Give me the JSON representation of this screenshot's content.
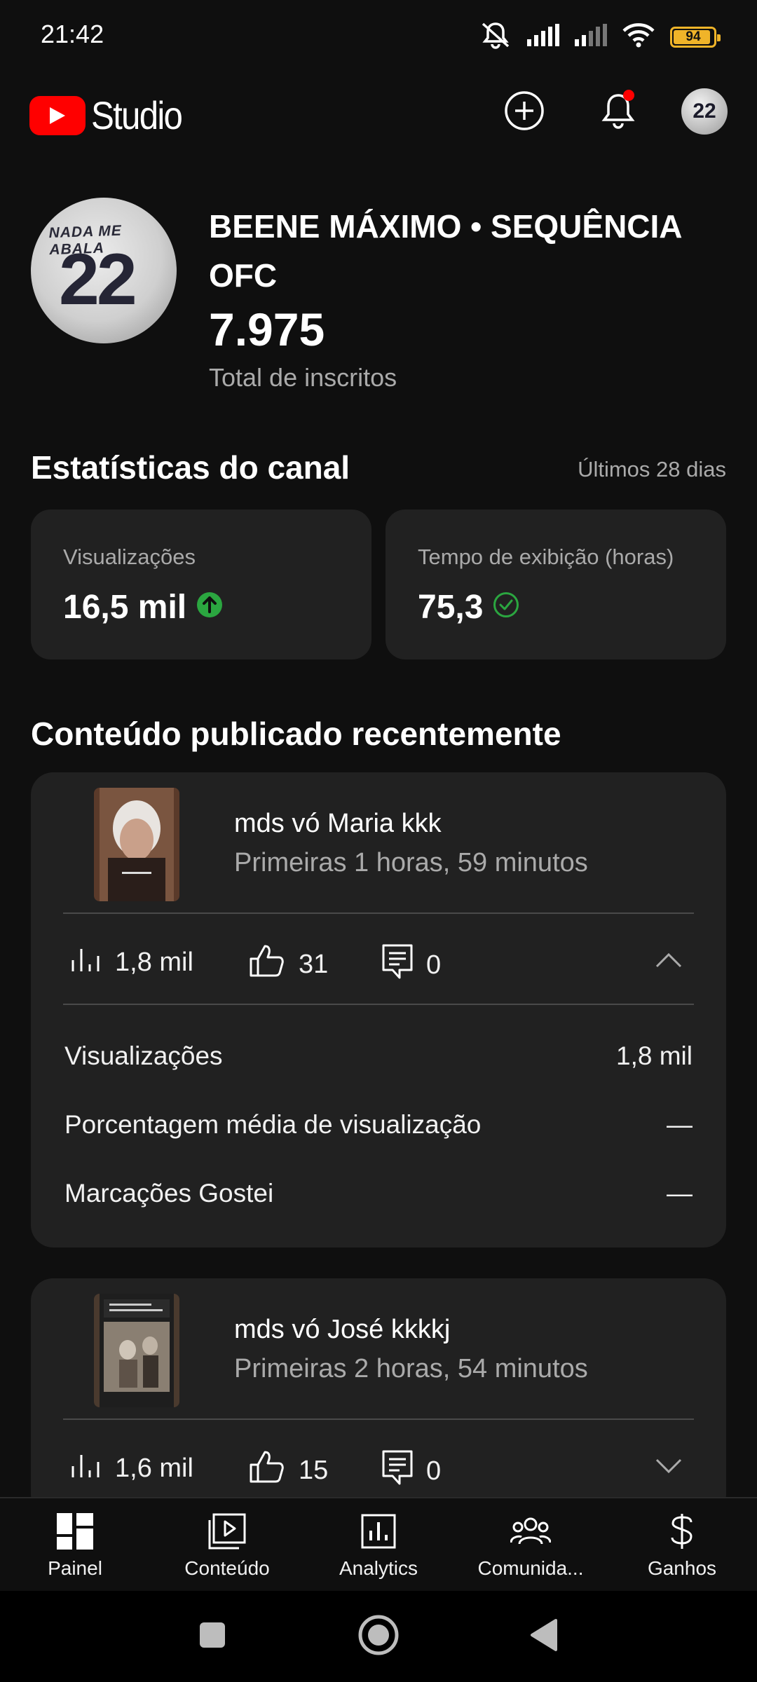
{
  "status_bar": {
    "time": "21:42",
    "battery": "94",
    "battery_level": 0.94,
    "icons": [
      "mute-icon",
      "signal-icon",
      "signal-icon",
      "wifi-icon",
      "battery-icon"
    ]
  },
  "header": {
    "app_name": "Studio",
    "avatar_text": "22"
  },
  "channel": {
    "name": "BEENE MÁXIMO • SEQUÊNCIA OFC",
    "subscribers": "7.975",
    "subscribers_label": "Total de inscritos",
    "avatar_top_text": "NADA ME ABALA",
    "avatar_number": "22"
  },
  "stats": {
    "title": "Estatísticas do canal",
    "period": "Últimos 28 dias",
    "cards": [
      {
        "label": "Visualizações",
        "value": "16,5 mil",
        "indicator": "arrow-up-icon",
        "indicator_color": "#2ba640"
      },
      {
        "label": "Tempo de exibição (horas)",
        "value": "75,3",
        "indicator": "check-circle-icon",
        "indicator_color": "#2ba640"
      }
    ]
  },
  "recent": {
    "title": "Conteúdo publicado recentemente",
    "videos": [
      {
        "title": "mds vó Maria kkk",
        "subtitle": "Primeiras 1 horas, 59 minutos",
        "views": "1,8 mil",
        "likes": "31",
        "comments": "0",
        "expanded": true,
        "details": [
          {
            "label": "Visualizações",
            "value": "1,8 mil"
          },
          {
            "label": "Porcentagem média de visualização",
            "value": "—"
          },
          {
            "label": "Marcações Gostei",
            "value": "—"
          }
        ]
      },
      {
        "title": "mds vó José kkkkj",
        "subtitle": "Primeiras 2 horas, 54 minutos",
        "views": "1,6 mil",
        "likes": "15",
        "comments": "0",
        "expanded": false
      }
    ]
  },
  "bottom_nav": [
    {
      "label": "Painel",
      "icon": "dashboard-icon",
      "active": true
    },
    {
      "label": "Conteúdo",
      "icon": "content-icon"
    },
    {
      "label": "Analytics",
      "icon": "analytics-icon"
    },
    {
      "label": "Comunida...",
      "icon": "community-icon"
    },
    {
      "label": "Ganhos",
      "icon": "earn-icon"
    }
  ],
  "colors": {
    "background": "#0f0f0f",
    "card": "#212121",
    "brand_red": "#ff0000",
    "positive_green": "#2ba640",
    "secondary_text": "#aaaaaa"
  }
}
